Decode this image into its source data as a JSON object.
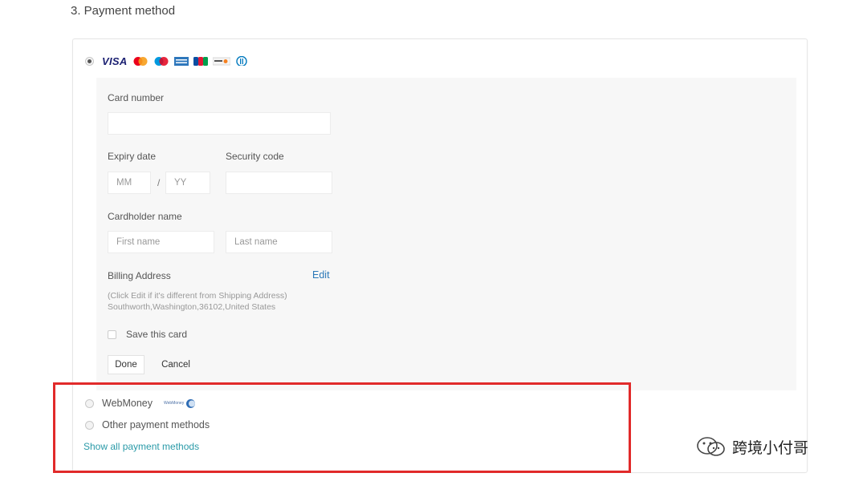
{
  "section": {
    "title": "3. Payment method"
  },
  "card_option": {
    "selected": true,
    "brand_text": "VISA",
    "logos": [
      "mastercard-icon",
      "maestro-icon",
      "amex-icon",
      "jcb-icon",
      "discover-icon",
      "diners-icon"
    ]
  },
  "form": {
    "card_number_label": "Card number",
    "card_number_value": "",
    "expiry_label": "Expiry date",
    "expiry_month_placeholder": "MM",
    "expiry_separator": "/",
    "expiry_year_placeholder": "YY",
    "security_label": "Security code",
    "security_value": "",
    "holder_label": "Cardholder name",
    "first_name_placeholder": "First name",
    "last_name_placeholder": "Last name",
    "billing_label": "Billing Address",
    "edit_label": "Edit",
    "billing_hint": "(Click Edit if it's different from Shipping Address)",
    "billing_address": "Southworth,Washington,36102,United States",
    "save_card_label": "Save this card",
    "save_card_checked": false,
    "done_label": "Done",
    "cancel_label": "Cancel"
  },
  "other_options": {
    "webmoney_label": "WebMoney",
    "webmoney_logo_text": "WebMoney",
    "other_label": "Other payment methods",
    "show_all_label": "Show all payment methods"
  },
  "watermark": {
    "text": "跨境小付哥"
  },
  "colors": {
    "link": "#2a78b8",
    "show_all_link": "#2a9aa8",
    "highlight_border": "#e12a2a",
    "visa": "#1a1f71",
    "form_background": "#f7f7f7"
  }
}
